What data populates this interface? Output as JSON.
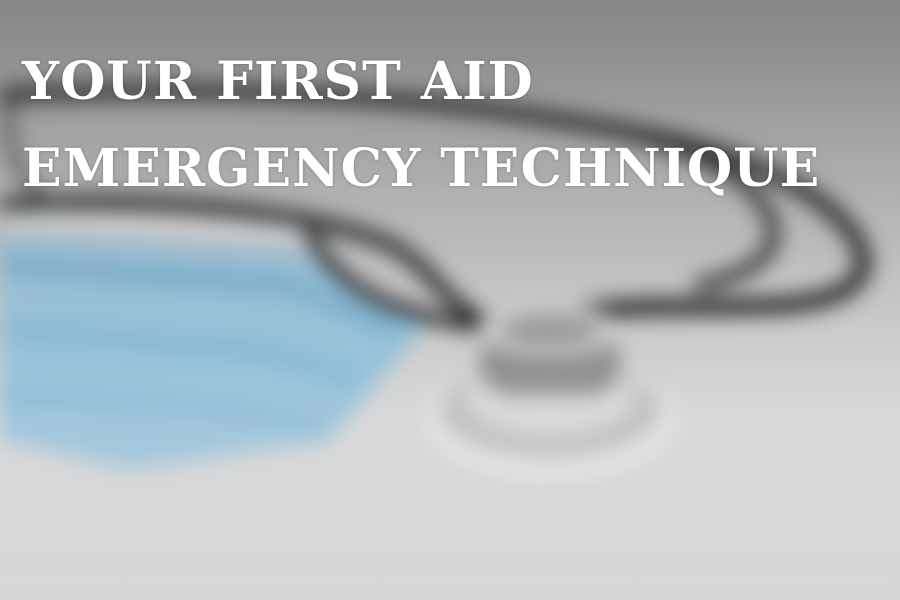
{
  "headline": {
    "line1": "YOUR FIRST AID",
    "line2": "EMERGENCY TECHNIQUE"
  },
  "colors": {
    "text": "#ffffff",
    "mask_blue": "#7fb4d6",
    "stethoscope": "#1c1c1c",
    "background": "#d0d0d0"
  }
}
